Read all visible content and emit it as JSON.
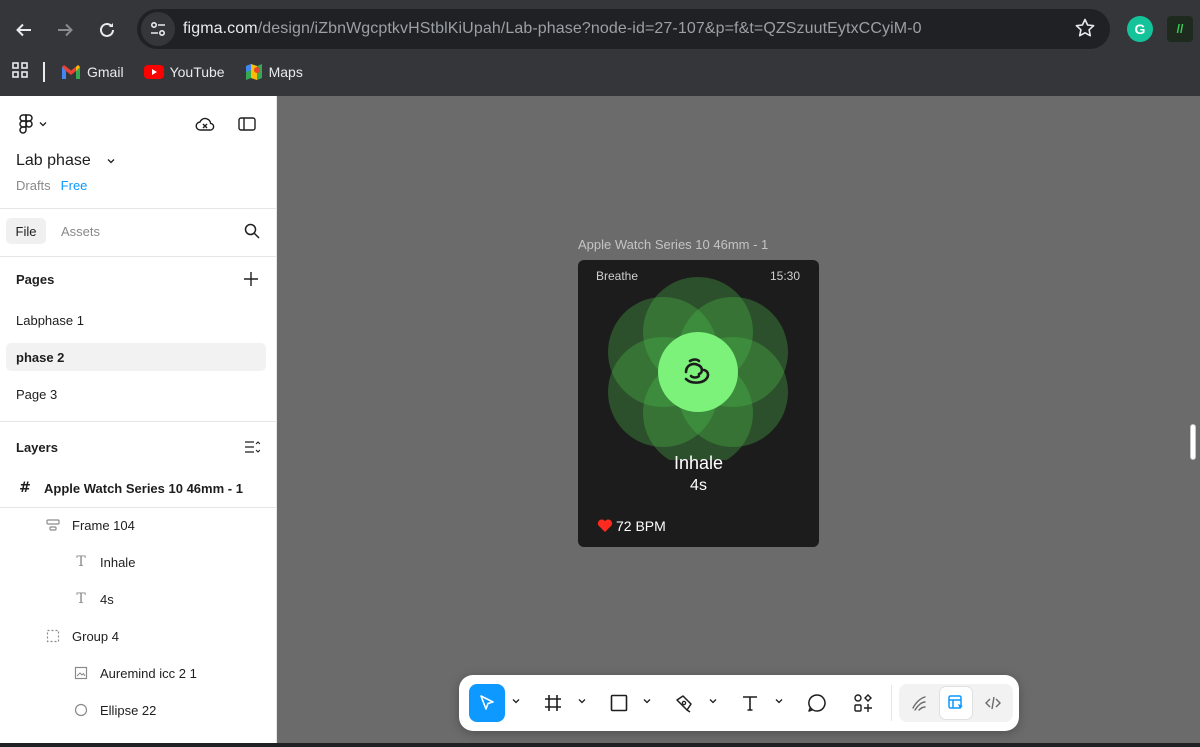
{
  "browser": {
    "url_host": "figma.com",
    "url_path": "/design/iZbnWgcptkvHStblKiUpah/Lab-phase?node-id=27-107&p=f&t=QZSzuutEytxCCyiM-0",
    "bookmarks": [
      {
        "label": "Gmail",
        "icon": "gmail-icon"
      },
      {
        "label": "YouTube",
        "icon": "youtube-icon"
      },
      {
        "label": "Maps",
        "icon": "maps-icon"
      }
    ],
    "extensions": [
      {
        "icon": "grammarly-icon",
        "glyph": "G",
        "color": "#15c39a"
      },
      {
        "icon": "extension-icon",
        "glyph": "//",
        "color": "#1e8e3e"
      }
    ]
  },
  "file": {
    "title": "Lab phase",
    "location": "Drafts",
    "plan": "Free"
  },
  "tabs": {
    "file": "File",
    "assets": "Assets"
  },
  "pages": {
    "title": "Pages",
    "items": [
      {
        "label": "Labphase 1",
        "selected": false
      },
      {
        "label": "phase 2",
        "selected": true
      },
      {
        "label": "Page 3",
        "selected": false
      }
    ]
  },
  "layers": {
    "title": "Layers",
    "root": "Apple Watch Series 10 46mm - 1",
    "items": [
      {
        "label": "Frame 104",
        "icon": "autolayout-icon",
        "depth": 1
      },
      {
        "label": "Inhale",
        "icon": "text-icon",
        "depth": 2
      },
      {
        "label": "4s",
        "icon": "text-icon",
        "depth": 2
      },
      {
        "label": "Group 4",
        "icon": "group-icon",
        "depth": 1
      },
      {
        "label": "Auremind icc 2 1",
        "icon": "image-icon",
        "depth": 2
      },
      {
        "label": "Ellipse 22",
        "icon": "ellipse-icon",
        "depth": 2
      }
    ]
  },
  "canvas": {
    "frame_label": "Apple Watch Series 10 46mm - 1",
    "watch": {
      "app_name": "Breathe",
      "time": "15:30",
      "phase": "Inhale",
      "duration": "4s",
      "heart_rate": "72 BPM",
      "accent": "#7cf27a"
    }
  },
  "toolbar": {
    "tools": [
      "move-tool",
      "frame-tool",
      "shape-tool",
      "pen-tool",
      "text-tool",
      "comment-tool",
      "actions-tool"
    ],
    "active_tool": "move-tool",
    "modes": [
      "draw-mode",
      "design-mode",
      "dev-mode"
    ],
    "selected_mode": "design-mode"
  }
}
